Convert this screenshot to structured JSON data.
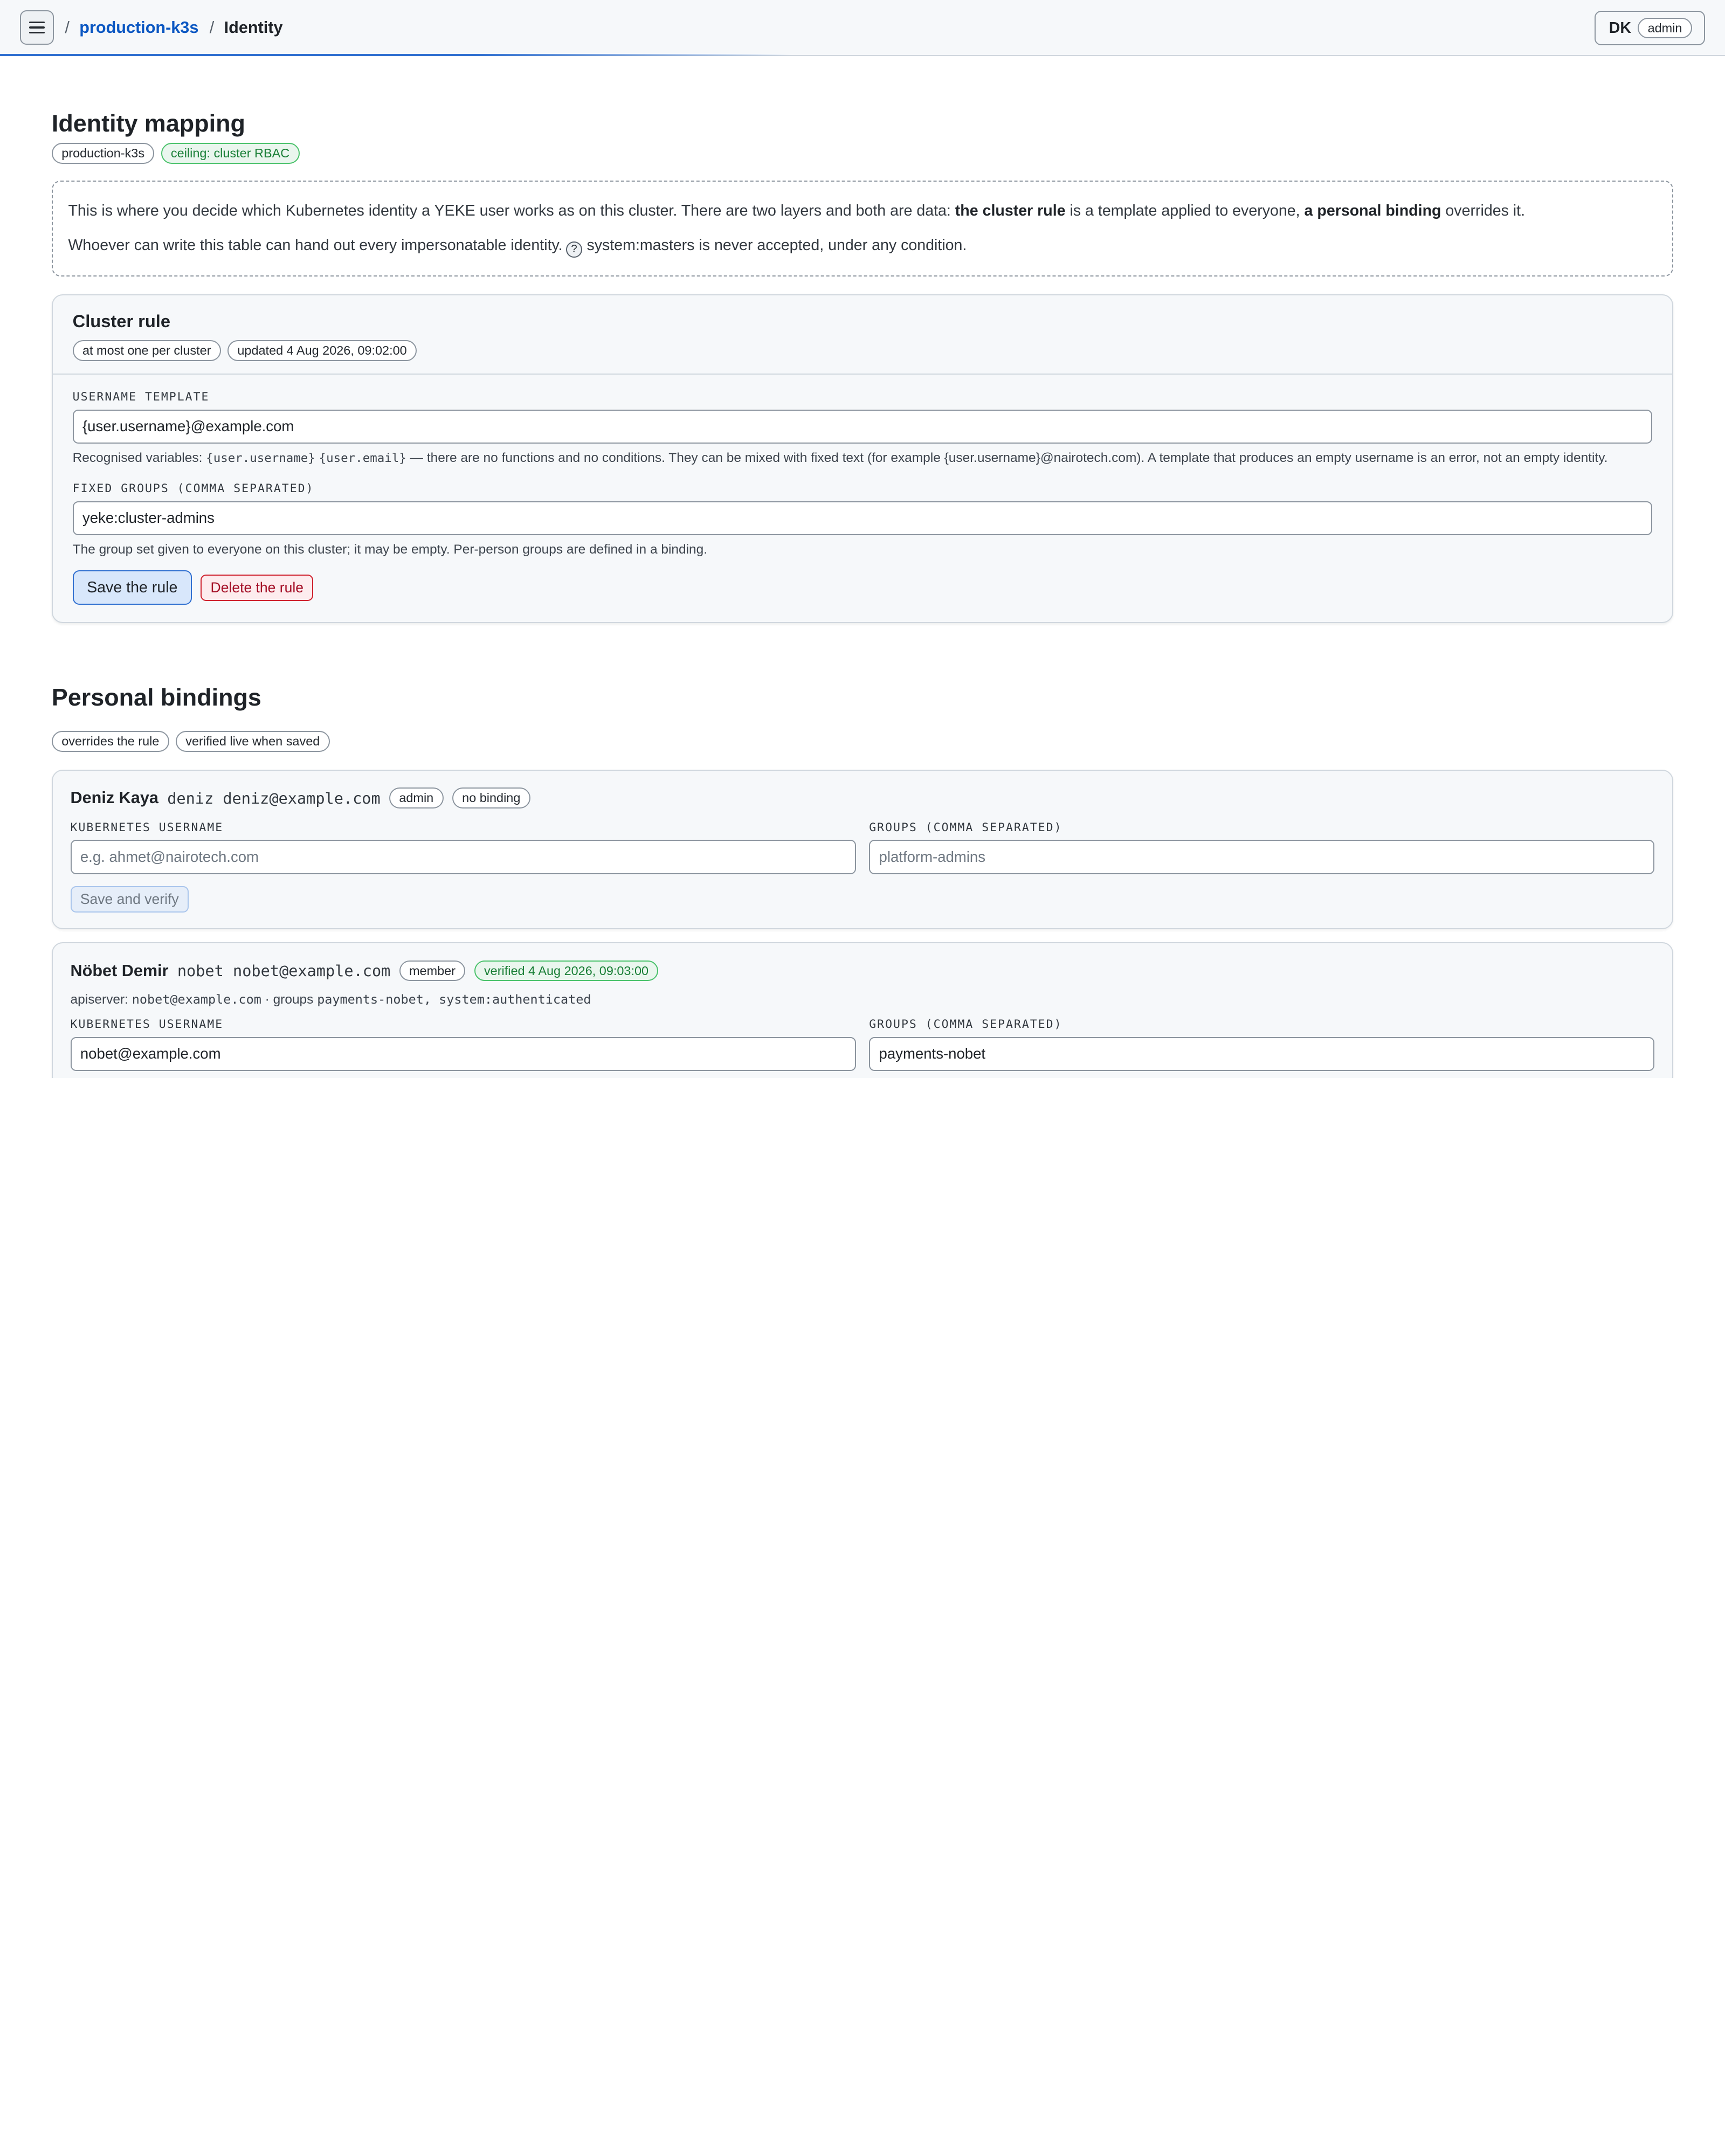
{
  "header": {
    "breadcrumb_sep": "/",
    "cluster_link": "production-k3s",
    "current_page": "Identity",
    "user_initials": "DK",
    "user_role": "admin"
  },
  "page": {
    "title": "Identity mapping",
    "pills": [
      "production-k3s",
      "ceiling: cluster RBAC"
    ]
  },
  "info": {
    "line1_a": "This is where you decide which Kubernetes identity a YEKE user works as on this cluster. There are two layers and both are data: ",
    "line1_b": "the cluster rule",
    "line1_c": " is a template applied to everyone, ",
    "line1_d": "a personal binding",
    "line1_e": " overrides it.",
    "line2_a": "Whoever can write this table can hand out every impersonatable identity.",
    "help_glyph": "?",
    "line2_b": "system:masters is never accepted, under any condition."
  },
  "cluster_rule": {
    "title": "Cluster rule",
    "pills": [
      "at most one per cluster",
      "updated 4 Aug 2026, 09:02:00"
    ],
    "username_label": "USERNAME TEMPLATE",
    "username_value": "{user.username}@example.com",
    "hint_a": "Recognised variables: ",
    "var1": "{user.username}",
    "var2": "{user.email}",
    "hint_b": " — there are no functions and no conditions. They can be mixed with fixed text (for example {user.username}@nairotech.com). A template that produces an empty username is an error, not an empty identity.",
    "groups_label": "FIXED GROUPS (COMMA SEPARATED)",
    "groups_value": "yeke:cluster-admins",
    "groups_hint": "The group set given to everyone on this cluster; it may be empty. Per-person groups are defined in a binding.",
    "save_label": "Save the rule",
    "delete_label": "Delete the rule"
  },
  "bindings_section": {
    "title": "Personal bindings",
    "pills": [
      "overrides the rule",
      "verified live when saved"
    ]
  },
  "bindings": [
    {
      "name": "Deniz Kaya",
      "login": "deniz deniz@example.com",
      "role": "admin",
      "status": "no binding",
      "k8s_label": "KUBERNETES USERNAME",
      "k8s_placeholder": "e.g. ahmet@nairotech.com",
      "groups_label": "GROUPS (COMMA SEPARATED)",
      "groups_placeholder": "platform-admins",
      "save_label": "Save and verify"
    },
    {
      "name": "Nöbet Demir",
      "login": "nobet nobet@example.com",
      "role": "member",
      "status": "verified 4 Aug 2026, 09:03:00",
      "apiserver_prefix": "apiserver: ",
      "apiserver_user": "nobet@example.com",
      "apiserver_mid": " · groups ",
      "apiserver_groups": "payments-nobet, system:authenticated",
      "k8s_label": "KUBERNETES USERNAME",
      "k8s_value": "nobet@example.com",
      "groups_label": "GROUPS (COMMA SEPARATED)",
      "groups_value": "payments-nobet"
    }
  ],
  "colors": {
    "accent": "#0b57c2",
    "success": "#1a7f37",
    "danger": "#a40e26"
  }
}
